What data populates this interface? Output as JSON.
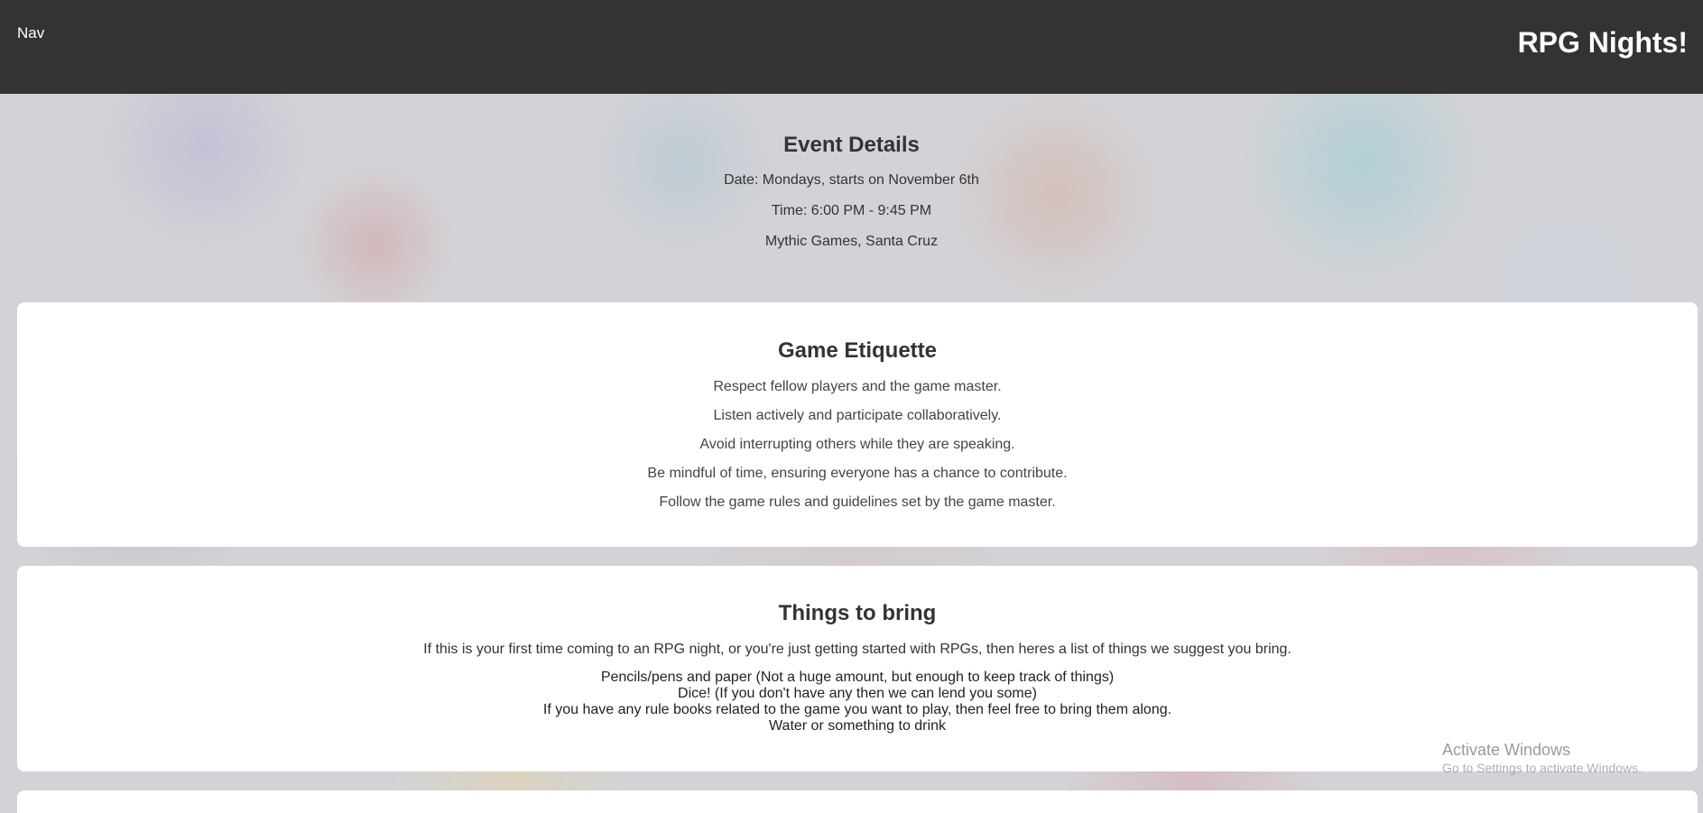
{
  "header": {
    "nav_label": "Nav",
    "site_title": "RPG Nights!"
  },
  "event_details": {
    "heading": "Event Details",
    "date": "Date: Mondays, starts on November 6th",
    "time": "Time: 6:00 PM - 9:45 PM",
    "location": "Mythic Games, Santa Cruz"
  },
  "etiquette": {
    "heading": "Game Etiquette",
    "items": [
      "Respect fellow players and the game master.",
      "Listen actively and participate collaboratively.",
      "Avoid interrupting others while they are speaking.",
      "Be mindful of time, ensuring everyone has a chance to contribute.",
      "Follow the game rules and guidelines set by the game master."
    ]
  },
  "things_to_bring": {
    "heading": "Things to bring",
    "intro": "If this is your first time coming to an RPG night, or you're just getting started with RPGs, then heres a list of things we suggest you bring.",
    "items": [
      "Pencils/pens and paper (Not a huge amount, but enough to keep track of things)",
      "Dice! (If you don't have any then we can lend you some)",
      "If you have any rule books related to the game you want to play, then feel free to bring them along.",
      "Water or something to drink"
    ]
  },
  "watermark": {
    "title": "Activate Windows",
    "subtitle": "Go to Settings to activate Windows."
  },
  "colors": {
    "header_bg": "#333333",
    "card_bg": "#ffffff",
    "text": "#333333"
  }
}
